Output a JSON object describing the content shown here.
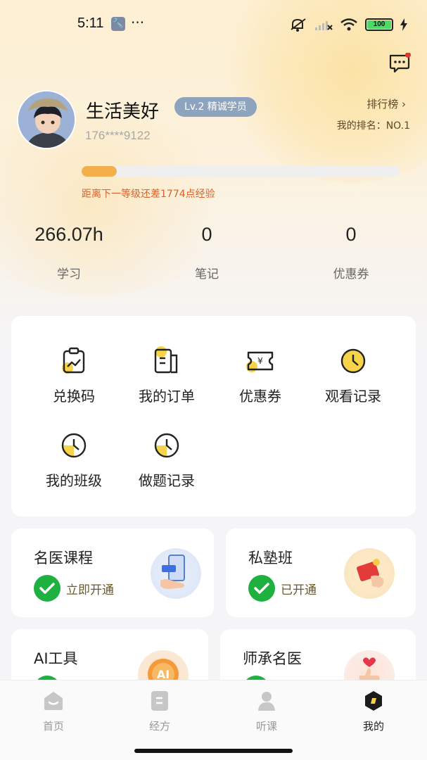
{
  "status_bar": {
    "time": "5:11",
    "battery": "100",
    "icons": [
      "wrench-icon",
      "more-dots-icon",
      "mute-icon",
      "signal-icon",
      "wifi-icon",
      "battery-icon",
      "charging-icon"
    ]
  },
  "header": {
    "message_icon": "message-icon"
  },
  "profile": {
    "username": "生活美好",
    "level_badge": "Lv.2 精诚学员",
    "phone": "176****9122",
    "rank_link": "排行榜 ›",
    "rank_text": "我的排名：NO.1",
    "progress_fraction": 0.11,
    "progress_hint": "距离下一等级还差1774点经验"
  },
  "stats": [
    {
      "value": "266.07h",
      "label": "学习"
    },
    {
      "value": "0",
      "label": "笔记"
    },
    {
      "value": "0",
      "label": "优惠券"
    }
  ],
  "functions": [
    {
      "label": "兑换码",
      "icon": "redeem-code-icon"
    },
    {
      "label": "我的订单",
      "icon": "order-icon"
    },
    {
      "label": "优惠券",
      "icon": "coupon-icon"
    },
    {
      "label": "观看记录",
      "icon": "clock-icon"
    },
    {
      "label": "我的班级",
      "icon": "clock-icon"
    },
    {
      "label": "做题记录",
      "icon": "clock-icon"
    }
  ],
  "promos": [
    {
      "title": "名医课程",
      "status": "立即开通",
      "icon": "phone-hand-icon"
    },
    {
      "title": "私塾班",
      "status": "已开通",
      "icon": "red-envelope-icon"
    },
    {
      "title": "AI工具",
      "status": "",
      "icon": "ai-badge-icon"
    },
    {
      "title": "师承名医",
      "status": "",
      "icon": "thumbs-up-heart-icon"
    }
  ],
  "tabs": [
    {
      "label": "首页",
      "icon": "home-icon",
      "active": false
    },
    {
      "label": "经方",
      "icon": "book-icon",
      "active": false
    },
    {
      "label": "听课",
      "icon": "person-icon",
      "active": false
    },
    {
      "label": "我的",
      "icon": "profile-hex-icon",
      "active": true
    }
  ],
  "colors": {
    "accent_orange": "#f3b04a",
    "hint_text": "#d9622b",
    "check_green": "#1fb140",
    "level_badge_bg": "#8ea3bd",
    "icon_yellow": "#f7d34a"
  }
}
